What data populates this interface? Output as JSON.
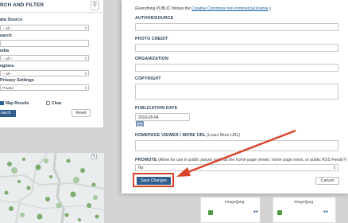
{
  "search_panel": {
    "title": "RCH AND FILTER",
    "help_icon": "lightbulb-icon",
    "data_source_label": "ata Source",
    "data_source_value": "-- all --",
    "search_label": "earch",
    "media_label": "edia",
    "media_value": "-- all --",
    "regions_label": "egions",
    "regions_value": "-- all --",
    "privacy_label": "Privacy Settings",
    "privacy_value": "Private",
    "map_results_label": "Map Results",
    "clear_label": "Clear",
    "search_button": "earch",
    "reset_button": "Reset"
  },
  "map": {
    "control_icon": "expand-icon"
  },
  "cards": [
    {
      "type": "image/jpeg"
    },
    {
      "type": "image/jpeg"
    }
  ],
  "form": {
    "cc_note_prefix": "(Everything PUBLIC follows the ",
    "cc_note_link": "Creative Commons non-commercial license",
    "cc_note_suffix": ".)",
    "author_label": "AUTHOR/SOURCE",
    "photo_credit_label": "PHOTO CREDIT",
    "organization_label": "ORGANIZATION",
    "copyright_label": "COPYRIGHT",
    "publication_date_label": "PUBLICATION DATE",
    "publication_date_value": "2016-05-04",
    "homepage_label": "HOMEPAGE VIEWER / MORE URL",
    "homepage_hint": " (Learn More URL)",
    "promote_label": "PROMOTE",
    "promote_hint": " (Allow for use in public places such as the home page viewer, home page news, or public RSS Feeds?)",
    "promote_value": "No",
    "save_button": "Save Changes",
    "cancel_button": "Cancel"
  },
  "colors": {
    "accent": "#2e5f8f",
    "highlight": "#d9442b"
  }
}
